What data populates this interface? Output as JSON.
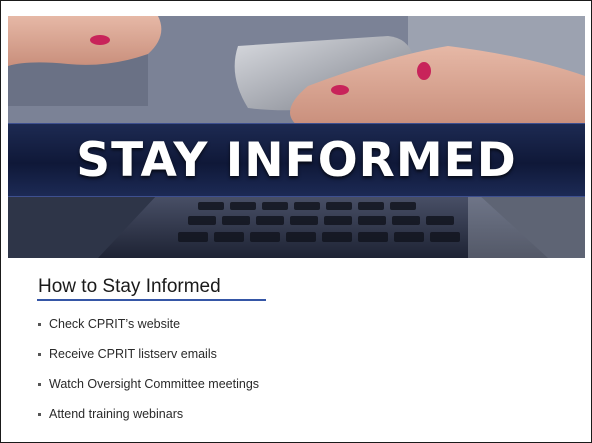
{
  "banner": {
    "headline": "STAY INFORMED"
  },
  "title": "How to Stay Informed",
  "bullets": [
    "Check CPRIT’s website",
    "Receive CPRIT listserv emails",
    "Watch Oversight Committee meetings",
    "Attend training webinars"
  ],
  "colors": {
    "band": "#0f1838",
    "title_rule": "#3556a6",
    "nail_polish": "#c8245a"
  },
  "icons": {
    "banner_image": "phone-and-laptop-photo"
  }
}
